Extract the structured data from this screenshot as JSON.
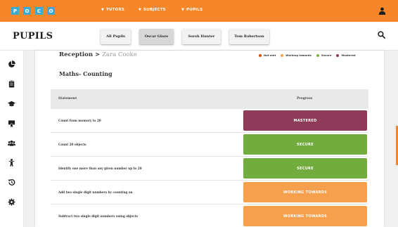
{
  "logo": {
    "letters": [
      "P",
      "O",
      "C",
      "O"
    ],
    "color": "#3fa9cf"
  },
  "topnav": [
    {
      "label": "TUTORS",
      "caret": "▼"
    },
    {
      "label": "SUBJECTS",
      "caret": "▼"
    },
    {
      "label": "PUPILS",
      "caret": "▼"
    }
  ],
  "header": {
    "title": "PUPILS",
    "tabs": [
      {
        "label": "All Pupils",
        "active": false
      },
      {
        "label": "Oscar Glaze",
        "active": true
      },
      {
        "label": "Sorsh Hunter",
        "active": false
      },
      {
        "label": "Tom Robertson",
        "active": false
      }
    ]
  },
  "sidebar": {
    "icons": [
      "pie-chart-icon",
      "clipboard-icon",
      "graduation-cap-icon",
      "certificate-icon",
      "users-icon",
      "child-icon",
      "history-icon",
      "gear-icon"
    ]
  },
  "breadcrumb": {
    "class_name": "Reception",
    "separator": ">",
    "pupil": "Zara Cooke"
  },
  "legend": [
    {
      "label": "Not met",
      "color": "#d35400"
    },
    {
      "label": "Working towards",
      "color": "#f6a04d"
    },
    {
      "label": "Secure",
      "color": "#7cb342"
    },
    {
      "label": "Mastered",
      "color": "#8e3a59"
    }
  ],
  "section_title": "Maths- Counting",
  "table": {
    "headers": {
      "statement": "Statement",
      "progress": "Progress"
    },
    "rows": [
      {
        "statement": "Count from memory to 20",
        "status": "MASTERED",
        "color": "#8e3a59"
      },
      {
        "statement": "Count 20 objects",
        "status": "SECURE",
        "color": "#72ab3e"
      },
      {
        "statement": "Identify one more than any given number up to 20",
        "status": "SECURE",
        "color": "#72ab3e"
      },
      {
        "statement": "Add two single digit numbers by counting on",
        "status": "WORKING TOWARDS",
        "color": "#f6a04d"
      },
      {
        "statement": "Subtract two single digit numbers using objects",
        "status": "WORKING TOWARDS",
        "color": "#f6a04d"
      }
    ]
  },
  "colors": {
    "accent": "#f6862a"
  }
}
